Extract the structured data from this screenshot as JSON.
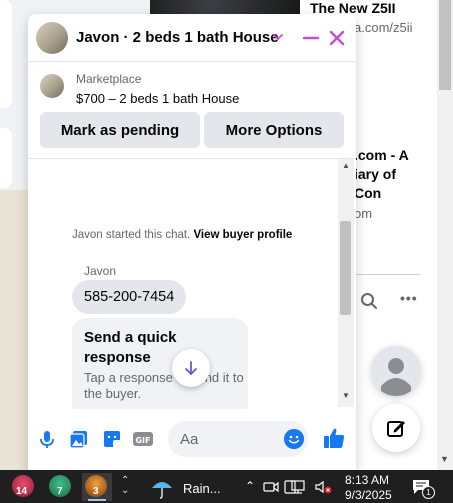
{
  "background": {
    "post_title": "The New Z5II",
    "post_url": "a.com/z5ii",
    "link_title": ".com - A\niary of\nCon",
    "link_domain": "om"
  },
  "chat": {
    "header_title": "Javon · 2 beds 1 bath House",
    "marketplace_label": "Marketplace",
    "listing": "$700 – 2 beds 1 bath House",
    "mark_pending": "Mark as pending",
    "more_options": "More Options",
    "started_text": "Javon started this chat.",
    "view_buyer": "View buyer profile",
    "sender": "Javon",
    "phone_message": "585-200-7454",
    "quick_response_title": "Send a quick response",
    "quick_response_sub": "Tap a response to send it to the buyer.",
    "input_placeholder": "Aa"
  },
  "taskbar": {
    "app1_badge": "14",
    "app2_badge": "7",
    "app3_badge": "3",
    "weather": "Rain...",
    "time": "8:13 AM",
    "date": "9/3/2025",
    "notif_count": "1"
  },
  "colors": {
    "accent": "#1877f2",
    "header_controls": "#c84bd6",
    "taskbar": "#1f1f1f"
  }
}
